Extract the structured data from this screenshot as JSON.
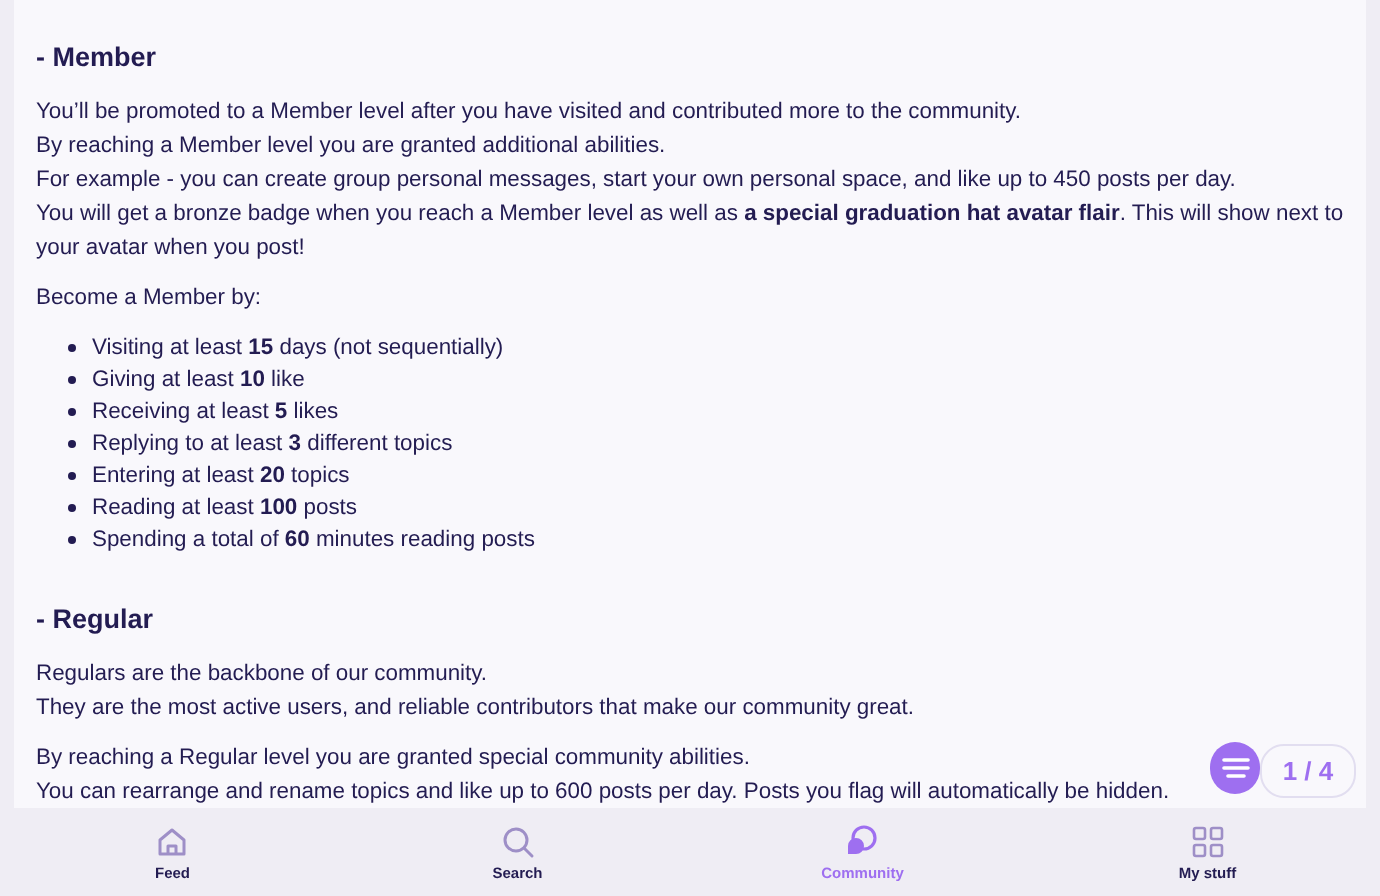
{
  "sections": [
    {
      "heading": "- Member",
      "blocks": [
        {
          "kind": "paragraph",
          "lines": [
            "You’ll be promoted to a Member level after you have visited and contributed more to the community.",
            "By reaching a Member level you are granted additional abilities.",
            "For example - you can create group personal messages, start your own personal space, and like up to 450 posts per day.",
            "You will get a bronze badge when you reach a Member level as well as **a special graduation hat avatar flair**. This will show next to your avatar when you post!"
          ]
        },
        {
          "kind": "paragraph",
          "lines": [
            "Become a Member by:"
          ]
        },
        {
          "kind": "list",
          "items": [
            "Visiting at least **15** days (not sequentially)",
            "Giving at least **10** like",
            "Receiving at least **5** likes",
            "Replying to at least **3** different topics",
            "Entering at least **20** topics",
            "Reading at least **100** posts",
            "Spending a total of **60** minutes reading posts"
          ]
        }
      ]
    },
    {
      "heading": "- Regular",
      "blocks": [
        {
          "kind": "paragraph",
          "lines": [
            "Regulars are the backbone of our community.",
            "They are the most active users, and reliable contributors that make our community great."
          ]
        },
        {
          "kind": "paragraph",
          "lines": [
            "By reaching a Regular level you are granted special community abilities.",
            "You can rearrange and rename topics and like up to 600 posts per day. Posts you flag will automatically be hidden."
          ]
        }
      ]
    }
  ],
  "progress": {
    "label": "1 / 4"
  },
  "nav": [
    {
      "label": "Feed",
      "kind": "home",
      "selected": false
    },
    {
      "label": "Search",
      "kind": "search",
      "selected": false
    },
    {
      "label": "Community",
      "kind": "chat",
      "selected": true
    },
    {
      "label": "My stuff",
      "kind": "grid",
      "selected": false
    }
  ]
}
